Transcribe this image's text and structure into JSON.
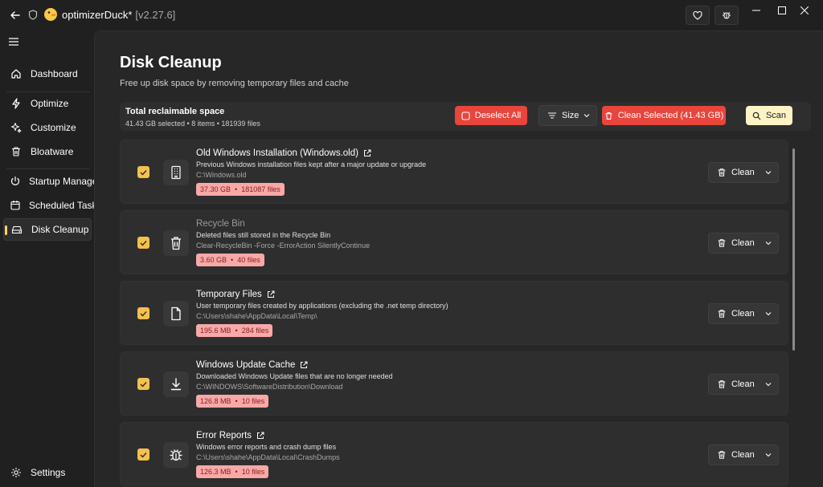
{
  "app": {
    "title": "optimizerDuck*",
    "version": "[v2.27.6]"
  },
  "icons": {
    "back": "arrow-left-icon",
    "shield": "shield-icon",
    "logo": "duck-logo-icon",
    "favorite": "heart-icon",
    "bug": "bug-icon",
    "minimize": "minimize-icon",
    "maximize": "maximize-icon",
    "close": "close-icon"
  },
  "sidebar": {
    "items": [
      {
        "label": "Dashboard",
        "icon": "home-icon"
      },
      {
        "label": "Optimize",
        "icon": "lightning-icon"
      },
      {
        "label": "Customize",
        "icon": "sparkle-icon"
      },
      {
        "label": "Bloatware",
        "icon": "trash-icon"
      },
      {
        "label": "Startup Manager",
        "icon": "power-icon"
      },
      {
        "label": "Scheduled Tasks",
        "icon": "calendar-icon"
      },
      {
        "label": "Disk Cleanup",
        "icon": "drive-icon"
      }
    ],
    "settings_label": "Settings"
  },
  "page": {
    "title": "Disk Cleanup",
    "subtitle": "Free up disk space by removing temporary files and cache"
  },
  "summary": {
    "title": "Total reclaimable space",
    "detail": "41.43 GB selected • 8 items • 181939 files",
    "deselect_label": "Deselect All",
    "sort_label": "Size",
    "clean_selected_label": "Clean Selected (41.43 GB)",
    "scan_label": "Scan"
  },
  "colors": {
    "accent_yellow": "#f2c14e",
    "danger_red": "#e8453c",
    "badge_bg": "#f7a9a8",
    "badge_text": "#8b1c1c",
    "scan_bg": "#fdf3c4"
  },
  "items": [
    {
      "title": "Old Windows Installation (Windows.old)",
      "description": "Previous Windows installation files kept after a major update or upgrade",
      "path": "C:\\Windows.old",
      "size": "37.30 GB",
      "files": "181087 files",
      "icon": "building-icon",
      "checked": true
    },
    {
      "title": "Recycle Bin",
      "description": "Deleted files still stored in the Recycle Bin",
      "path": "Clear-RecycleBin -Force -ErrorAction SilentlyContinue",
      "size": "3.60 GB",
      "files": "40 files",
      "icon": "trash-icon",
      "checked": true
    },
    {
      "title": "Temporary Files",
      "description": "User temporary files created by applications (excluding the .net temp directory)",
      "path": "C:\\Users\\shahe\\AppData\\Local\\Temp\\",
      "size": "195.6 MB",
      "files": "284 files",
      "icon": "document-icon",
      "checked": true
    },
    {
      "title": "Windows Update Cache",
      "description": "Downloaded Windows Update files that are no longer needed",
      "path": "C:\\WINDOWS\\SoftwareDistribution\\Download",
      "size": "126.8 MB",
      "files": "10 files",
      "icon": "download-icon",
      "checked": true
    },
    {
      "title": "Error Reports",
      "description": "Windows error reports and crash dump files",
      "path": "C:\\Users\\shahe\\AppData\\Local\\CrashDumps",
      "size": "126.3 MB",
      "files": "10 files",
      "icon": "bug-icon",
      "checked": true
    }
  ],
  "clean_label": "Clean"
}
